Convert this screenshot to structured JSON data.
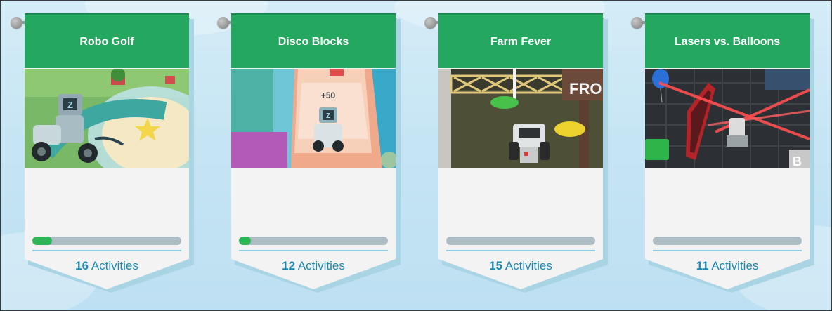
{
  "cards": [
    {
      "title": "Robo Golf",
      "count": "16",
      "count_label": " Activities",
      "progress": 0.13
    },
    {
      "title": "Disco Blocks",
      "count": "12",
      "count_label": " Activities",
      "progress": 0.08
    },
    {
      "title": "Farm Fever",
      "count": "15",
      "count_label": " Activities",
      "progress": 0
    },
    {
      "title": "Lasers vs. Balloons",
      "count": "11",
      "count_label": " Activities",
      "progress": 0
    }
  ],
  "scene_text": {
    "disco_score": "+50",
    "farm_sign": "FRO",
    "lasers_sign": "B"
  },
  "colors": {
    "title_bar": "#24a860",
    "progress_fill": "#2eb557",
    "progress_track": "#aebcc4",
    "activity_text": "#1e87b0",
    "background": "#c6e5f4"
  }
}
